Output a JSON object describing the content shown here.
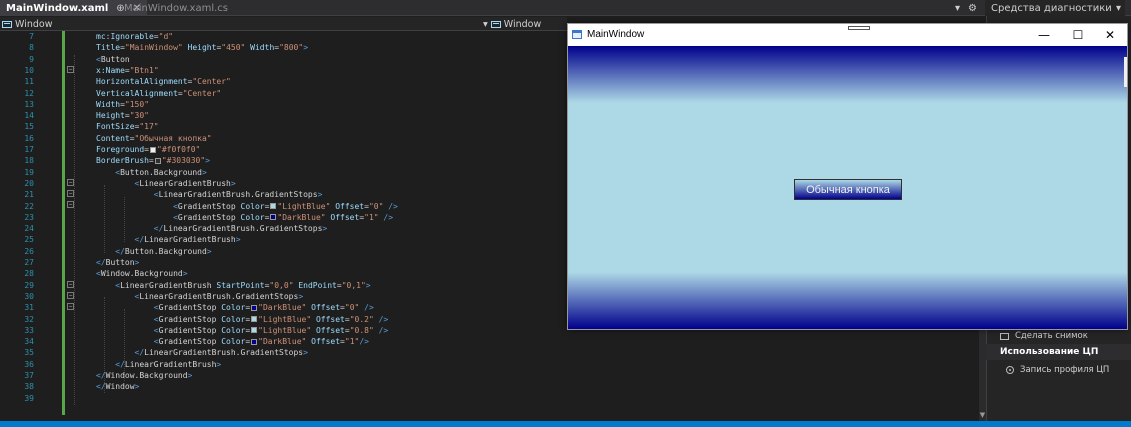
{
  "tabs": {
    "active": "MainWindow.xaml",
    "active_pin": "⊕",
    "active_close": "✕",
    "inactive": "MainWindow.xaml.cs",
    "right_arrow": "▾",
    "right_gear": "⚙",
    "diagnostics_label": "Средства диагностики",
    "diagnostics_arrow": "▾"
  },
  "navbar": {
    "left_label": "Window",
    "dropdown_arrow": "▾",
    "right_label": "Window"
  },
  "app": {
    "title": "MainWindow",
    "minimize": "—",
    "maximize": "☐",
    "close": "✕",
    "button_label": "Обычная кнопка"
  },
  "diagnostics": {
    "snapshot": "Сделать снимок",
    "cpu_heading": "Использование ЦП",
    "record_profile": "Запись профиля ЦП"
  },
  "code": {
    "lines": [
      {
        "n": "7",
        "tokens": [
          {
            "c": "t-attr",
            "t": "mc:Ignorable"
          },
          {
            "c": "t-eq",
            "t": "="
          },
          {
            "c": "t-val",
            "t": "\"d\""
          }
        ]
      },
      {
        "n": "8",
        "tokens": [
          {
            "c": "t-attr",
            "t": "Title"
          },
          {
            "c": "t-eq",
            "t": "="
          },
          {
            "c": "t-val",
            "t": "\"MainWindow\""
          },
          {
            "c": "t-attr",
            "t": " Height"
          },
          {
            "c": "t-eq",
            "t": "="
          },
          {
            "c": "t-val",
            "t": "\"450\""
          },
          {
            "c": "t-attr",
            "t": " Width"
          },
          {
            "c": "t-eq",
            "t": "="
          },
          {
            "c": "t-val",
            "t": "\"800\""
          },
          {
            "c": "t-tag",
            "t": ">"
          }
        ]
      },
      {
        "n": "9",
        "tokens": [
          {
            "c": "t-tag",
            "t": "<"
          },
          {
            "c": "t-elw",
            "t": "Button"
          }
        ]
      },
      {
        "n": "10",
        "tokens": [
          {
            "c": "t-attr",
            "t": "x:Name"
          },
          {
            "c": "t-eq",
            "t": "="
          },
          {
            "c": "t-val",
            "t": "\"Btn1\""
          }
        ]
      },
      {
        "n": "11",
        "tokens": [
          {
            "c": "t-attr",
            "t": "HorizontalAlignment"
          },
          {
            "c": "t-eq",
            "t": "="
          },
          {
            "c": "t-val",
            "t": "\"Center\""
          }
        ]
      },
      {
        "n": "12",
        "tokens": [
          {
            "c": "t-attr",
            "t": "VerticalAlignment"
          },
          {
            "c": "t-eq",
            "t": "="
          },
          {
            "c": "t-val",
            "t": "\"Center\""
          }
        ]
      },
      {
        "n": "13",
        "tokens": [
          {
            "c": "t-attr",
            "t": "Width"
          },
          {
            "c": "t-eq",
            "t": "="
          },
          {
            "c": "t-val",
            "t": "\"150\""
          }
        ]
      },
      {
        "n": "14",
        "tokens": [
          {
            "c": "t-attr",
            "t": "Height"
          },
          {
            "c": "t-eq",
            "t": "="
          },
          {
            "c": "t-val",
            "t": "\"30\""
          }
        ]
      },
      {
        "n": "15",
        "tokens": [
          {
            "c": "t-attr",
            "t": "FontSize"
          },
          {
            "c": "t-eq",
            "t": "="
          },
          {
            "c": "t-val",
            "t": "\"17\""
          }
        ]
      },
      {
        "n": "16",
        "tokens": [
          {
            "c": "t-attr",
            "t": "Content"
          },
          {
            "c": "t-eq",
            "t": "="
          },
          {
            "c": "t-val",
            "t": "\"Обычная кнопка\""
          }
        ]
      },
      {
        "n": "17",
        "tokens": [
          {
            "c": "t-attr",
            "t": "Foreground"
          },
          {
            "c": "t-eq",
            "t": "="
          },
          {
            "sw": "#f0f0f0"
          },
          {
            "c": "t-val",
            "t": "\"#f0f0f0\""
          }
        ]
      },
      {
        "n": "18",
        "tokens": [
          {
            "c": "t-attr",
            "t": "BorderBrush"
          },
          {
            "c": "t-eq",
            "t": "="
          },
          {
            "sw": "#303030"
          },
          {
            "c": "t-val",
            "t": "\"#303030\""
          },
          {
            "c": "t-tag",
            "t": ">"
          }
        ]
      },
      {
        "n": "19",
        "tokens": [
          {
            "c": "t-tag",
            "t": "    <"
          },
          {
            "c": "t-elw",
            "t": "Button.Background"
          },
          {
            "c": "t-tag",
            "t": ">"
          }
        ]
      },
      {
        "n": "20",
        "tokens": [
          {
            "c": "t-tag",
            "t": "        <"
          },
          {
            "c": "t-elw",
            "t": "LinearGradientBrush"
          },
          {
            "c": "t-tag",
            "t": ">"
          }
        ]
      },
      {
        "n": "21",
        "tokens": [
          {
            "c": "t-tag",
            "t": "            <"
          },
          {
            "c": "t-elw",
            "t": "LinearGradientBrush.GradientStops"
          },
          {
            "c": "t-tag",
            "t": ">"
          }
        ]
      },
      {
        "n": "22",
        "tokens": [
          {
            "c": "t-tag",
            "t": "                <"
          },
          {
            "c": "t-elw",
            "t": "GradientStop"
          },
          {
            "c": "t-attr",
            "t": " Color"
          },
          {
            "c": "t-eq",
            "t": "="
          },
          {
            "sw": "#add8e6"
          },
          {
            "c": "t-val",
            "t": "\"LightBlue\""
          },
          {
            "c": "t-attr",
            "t": " Offset"
          },
          {
            "c": "t-eq",
            "t": "="
          },
          {
            "c": "t-val",
            "t": "\"0\""
          },
          {
            "c": "t-tag",
            "t": " />"
          }
        ]
      },
      {
        "n": "23",
        "tokens": [
          {
            "c": "t-tag",
            "t": "                <"
          },
          {
            "c": "t-elw",
            "t": "GradientStop"
          },
          {
            "c": "t-attr",
            "t": " Color"
          },
          {
            "c": "t-eq",
            "t": "="
          },
          {
            "sw": "#00008b"
          },
          {
            "c": "t-val",
            "t": "\"DarkBlue\""
          },
          {
            "c": "t-attr",
            "t": " Offset"
          },
          {
            "c": "t-eq",
            "t": "="
          },
          {
            "c": "t-val",
            "t": "\"1\""
          },
          {
            "c": "t-tag",
            "t": " />"
          }
        ]
      },
      {
        "n": "24",
        "tokens": [
          {
            "c": "t-tag",
            "t": "            </"
          },
          {
            "c": "t-elw",
            "t": "LinearGradientBrush.GradientStops"
          },
          {
            "c": "t-tag",
            "t": ">"
          }
        ]
      },
      {
        "n": "25",
        "tokens": [
          {
            "c": "t-tag",
            "t": "        </"
          },
          {
            "c": "t-elw",
            "t": "LinearGradientBrush"
          },
          {
            "c": "t-tag",
            "t": ">"
          }
        ]
      },
      {
        "n": "26",
        "tokens": [
          {
            "c": "t-tag",
            "t": "    </"
          },
          {
            "c": "t-elw",
            "t": "Button.Background"
          },
          {
            "c": "t-tag",
            "t": ">"
          }
        ]
      },
      {
        "n": "27",
        "tokens": [
          {
            "c": "t-tag",
            "t": "</"
          },
          {
            "c": "t-elw",
            "t": "Button"
          },
          {
            "c": "t-tag",
            "t": ">"
          }
        ]
      },
      {
        "n": "28",
        "tokens": [
          {
            "c": "t-tag",
            "t": "<"
          },
          {
            "c": "t-elw",
            "t": "Window.Background"
          },
          {
            "c": "t-tag",
            "t": ">"
          }
        ]
      },
      {
        "n": "29",
        "tokens": [
          {
            "c": "t-tag",
            "t": "    <"
          },
          {
            "c": "t-elw",
            "t": "LinearGradientBrush"
          },
          {
            "c": "t-attr",
            "t": " StartPoint"
          },
          {
            "c": "t-eq",
            "t": "="
          },
          {
            "c": "t-val",
            "t": "\"0,0\""
          },
          {
            "c": "t-attr",
            "t": " EndPoint"
          },
          {
            "c": "t-eq",
            "t": "="
          },
          {
            "c": "t-val",
            "t": "\"0,1\""
          },
          {
            "c": "t-tag",
            "t": ">"
          }
        ]
      },
      {
        "n": "30",
        "tokens": [
          {
            "c": "t-tag",
            "t": "        <"
          },
          {
            "c": "t-elw",
            "t": "LinearGradientBrush.GradientStops"
          },
          {
            "c": "t-tag",
            "t": ">"
          }
        ]
      },
      {
        "n": "31",
        "tokens": [
          {
            "c": "t-tag",
            "t": "            <"
          },
          {
            "c": "t-elw",
            "t": "GradientStop"
          },
          {
            "c": "t-attr",
            "t": " Color"
          },
          {
            "c": "t-eq",
            "t": "="
          },
          {
            "sw": "#00008b"
          },
          {
            "c": "t-val",
            "t": "\"DarkBlue\""
          },
          {
            "c": "t-attr",
            "t": " Offset"
          },
          {
            "c": "t-eq",
            "t": "="
          },
          {
            "c": "t-val",
            "t": "\"0\""
          },
          {
            "c": "t-tag",
            "t": " />"
          }
        ]
      },
      {
        "n": "32",
        "tokens": [
          {
            "c": "t-tag",
            "t": "            <"
          },
          {
            "c": "t-elw",
            "t": "GradientStop"
          },
          {
            "c": "t-attr",
            "t": " Color"
          },
          {
            "c": "t-eq",
            "t": "="
          },
          {
            "sw": "#add8e6"
          },
          {
            "c": "t-val",
            "t": "\"LightBlue\""
          },
          {
            "c": "t-attr",
            "t": " Offset"
          },
          {
            "c": "t-eq",
            "t": "="
          },
          {
            "c": "t-val",
            "t": "\"0.2\""
          },
          {
            "c": "t-tag",
            "t": " />"
          }
        ]
      },
      {
        "n": "33",
        "tokens": [
          {
            "c": "t-tag",
            "t": "            <"
          },
          {
            "c": "t-elw",
            "t": "GradientStop"
          },
          {
            "c": "t-attr",
            "t": " Color"
          },
          {
            "c": "t-eq",
            "t": "="
          },
          {
            "sw": "#add8e6"
          },
          {
            "c": "t-val",
            "t": "\"LightBlue\""
          },
          {
            "c": "t-attr",
            "t": " Offset"
          },
          {
            "c": "t-eq",
            "t": "="
          },
          {
            "c": "t-val",
            "t": "\"0.8\""
          },
          {
            "c": "t-tag",
            "t": " />"
          }
        ]
      },
      {
        "n": "34",
        "tokens": [
          {
            "c": "t-tag",
            "t": "            <"
          },
          {
            "c": "t-elw",
            "t": "GradientStop"
          },
          {
            "c": "t-attr",
            "t": " Color"
          },
          {
            "c": "t-eq",
            "t": "="
          },
          {
            "sw": "#00008b"
          },
          {
            "c": "t-val",
            "t": "\"DarkBlue\""
          },
          {
            "c": "t-attr",
            "t": " Offset"
          },
          {
            "c": "t-eq",
            "t": "="
          },
          {
            "c": "t-val",
            "t": "\"1\""
          },
          {
            "c": "t-tag",
            "t": "/>"
          }
        ]
      },
      {
        "n": "35",
        "tokens": [
          {
            "c": "t-tag",
            "t": "        </"
          },
          {
            "c": "t-elw",
            "t": "LinearGradientBrush.GradientStops"
          },
          {
            "c": "t-tag",
            "t": ">"
          }
        ]
      },
      {
        "n": "36",
        "tokens": [
          {
            "c": "t-tag",
            "t": "    </"
          },
          {
            "c": "t-elw",
            "t": "LinearGradientBrush"
          },
          {
            "c": "t-tag",
            "t": ">"
          }
        ]
      },
      {
        "n": "37",
        "tokens": [
          {
            "c": "t-tag",
            "t": "</"
          },
          {
            "c": "t-elw",
            "t": "Window.Background"
          },
          {
            "c": "t-tag",
            "t": ">"
          }
        ]
      },
      {
        "n": "38",
        "tokens": [
          {
            "c": "t-tag",
            "t": "</"
          },
          {
            "c": "t-elw",
            "t": "Window"
          },
          {
            "c": "t-tag",
            "t": ">"
          }
        ]
      },
      {
        "n": "39",
        "tokens": []
      }
    ]
  }
}
